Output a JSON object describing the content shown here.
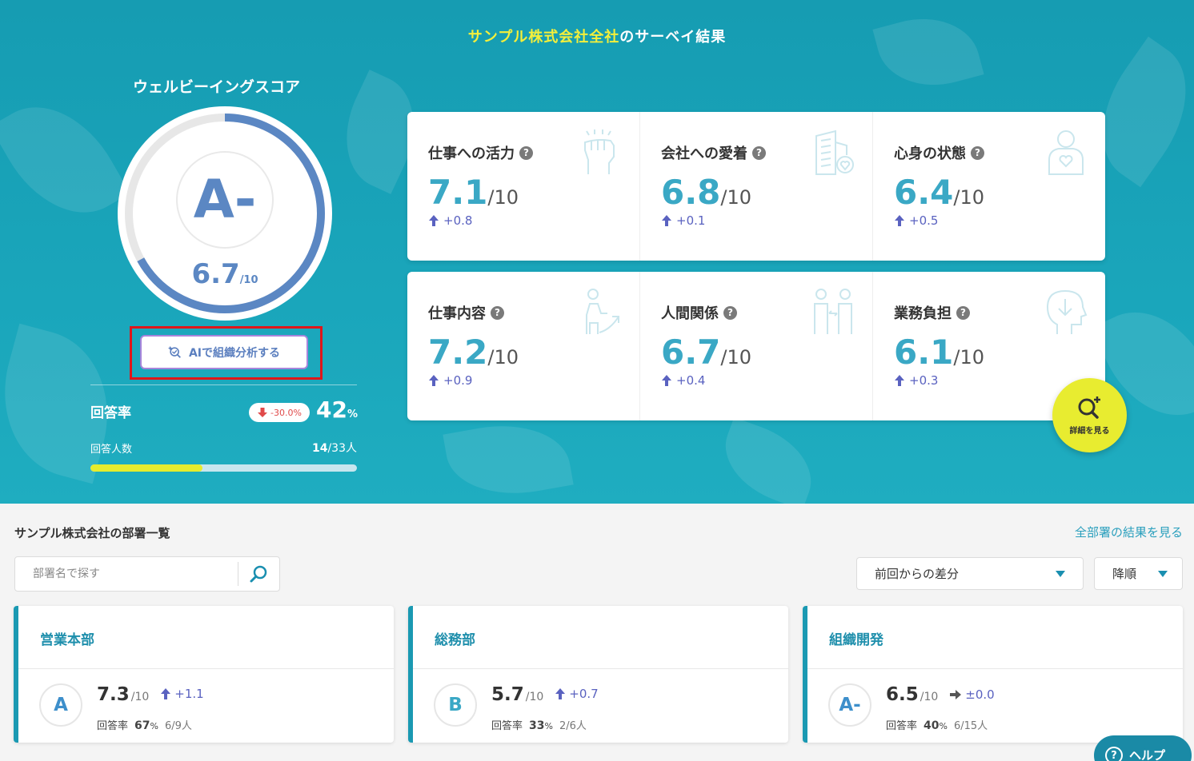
{
  "header": {
    "title_highlight": "サンプル株式会社全社",
    "title_rest": "のサーベイ結果"
  },
  "wellbeing": {
    "label": "ウェルビーイングスコア",
    "grade": "A-",
    "score": "6.7",
    "denominator": "/10",
    "ring_fraction": 0.67,
    "ai_button": "AIで組織分析する"
  },
  "response": {
    "rate_label": "回答率",
    "rate_change": "-30.0%",
    "rate_value": "42",
    "rate_unit": "%",
    "count_label": "回答人数",
    "count_value": "14",
    "count_total": "/33人",
    "progress_fraction": 0.42
  },
  "metrics": [
    {
      "name": "仕事への活力",
      "value": "7.1",
      "den": "/10",
      "diff": "+0.8",
      "icon": "fist-icon"
    },
    {
      "name": "会社への愛着",
      "value": "6.8",
      "den": "/10",
      "diff": "+0.1",
      "icon": "building-heart-icon"
    },
    {
      "name": "心身の状態",
      "value": "6.4",
      "den": "/10",
      "diff": "+0.5",
      "icon": "person-heart-icon"
    },
    {
      "name": "仕事内容",
      "value": "7.2",
      "den": "/10",
      "diff": "+0.9",
      "icon": "growth-person-icon"
    },
    {
      "name": "人間関係",
      "value": "6.7",
      "den": "/10",
      "diff": "+0.4",
      "icon": "two-people-icon"
    },
    {
      "name": "業務負担",
      "value": "6.1",
      "den": "/10",
      "diff": "+0.3",
      "icon": "head-arrow-icon"
    }
  ],
  "detail_button": "詳細を見る",
  "departments": {
    "title": "サンプル株式会社の部署一覧",
    "all_link": "全部署の結果を見る",
    "search_placeholder": "部署名で探す",
    "sort_field": "前回からの差分",
    "sort_order": "降順",
    "rate_label": "回答率",
    "items": [
      {
        "name": "営業本部",
        "grade": "A",
        "score": "7.3",
        "den": "/10",
        "diff": "+1.1",
        "trend": "up",
        "rate": "67",
        "rate_unit": "%",
        "count": "6/9人"
      },
      {
        "name": "総務部",
        "grade": "B",
        "score": "5.7",
        "den": "/10",
        "diff": "+0.7",
        "trend": "up",
        "rate": "33",
        "rate_unit": "%",
        "count": "2/6人"
      },
      {
        "name": "組織開発",
        "grade": "A-",
        "score": "6.5",
        "den": "/10",
        "diff": "±0.0",
        "trend": "flat",
        "rate": "40",
        "rate_unit": "%",
        "count": "6/15人"
      }
    ]
  },
  "help_button": "ヘルプ",
  "colors": {
    "hero_bg": "#169cb2",
    "accent_blue": "#5b87c3",
    "score_teal": "#3aa8c5",
    "diff_purple": "#5a62c0",
    "highlight_yellow": "#f3ef3b",
    "alert_red": "#e0161a"
  }
}
